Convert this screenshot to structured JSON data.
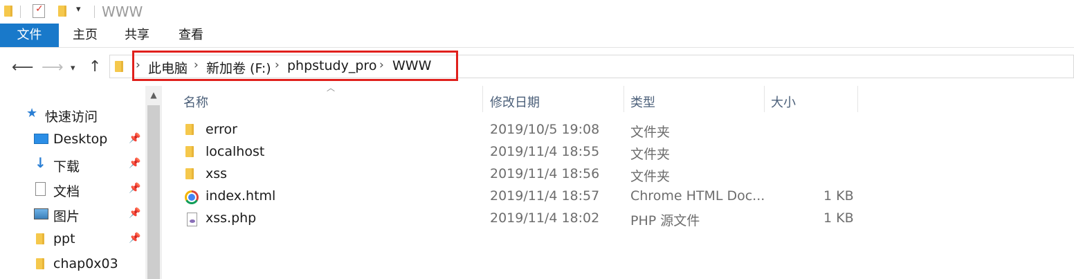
{
  "window": {
    "title": "WWW"
  },
  "ribbon": {
    "tabs": [
      {
        "label": "文件",
        "active": true
      },
      {
        "label": "主页"
      },
      {
        "label": "共享"
      },
      {
        "label": "查看"
      }
    ]
  },
  "address": {
    "crumbs": [
      "此电脑",
      "新加卷 (F:)",
      "phpstudy_pro",
      "WWW"
    ],
    "highlight_color": "#e0201c"
  },
  "nav_pane": {
    "quick_access_label": "快速访问",
    "items": [
      {
        "label": "Desktop",
        "icon": "desktop-icon",
        "pinned": true
      },
      {
        "label": "下载",
        "icon": "download-arrow-icon",
        "pinned": true
      },
      {
        "label": "文档",
        "icon": "document-icon",
        "pinned": true
      },
      {
        "label": "图片",
        "icon": "pictures-icon",
        "pinned": true
      },
      {
        "label": "ppt",
        "icon": "folder-icon",
        "pinned": true
      },
      {
        "label": "chap0x03",
        "icon": "folder-icon",
        "pinned": false
      }
    ]
  },
  "file_list": {
    "columns": {
      "name": "名称",
      "date": "修改日期",
      "type": "类型",
      "size": "大小"
    },
    "rows": [
      {
        "name": "error",
        "date": "2019/10/5 19:08",
        "type": "文件夹",
        "size": "",
        "icon": "folder-icon"
      },
      {
        "name": "localhost",
        "date": "2019/11/4 18:55",
        "type": "文件夹",
        "size": "",
        "icon": "folder-icon"
      },
      {
        "name": "xss",
        "date": "2019/11/4 18:56",
        "type": "文件夹",
        "size": "",
        "icon": "folder-icon"
      },
      {
        "name": "index.html",
        "date": "2019/11/4 18:57",
        "type": "Chrome HTML Doc...",
        "size": "1 KB",
        "icon": "chrome-icon"
      },
      {
        "name": "xss.php",
        "date": "2019/11/4 18:02",
        "type": "PHP 源文件",
        "size": "1 KB",
        "icon": "php-file-icon"
      }
    ]
  },
  "colors": {
    "accent": "#1979ca",
    "header_text": "#4c607a",
    "secondary_text": "#6d6d6d"
  }
}
